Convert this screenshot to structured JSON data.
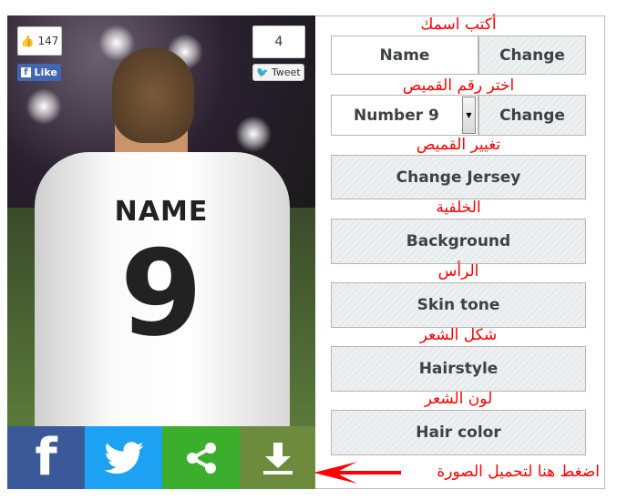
{
  "social": {
    "likes": "147",
    "like_label": "Like",
    "tweets": "4",
    "tweet_label": "Tweet"
  },
  "jersey": {
    "name": "NAME",
    "number": "9"
  },
  "share_bar": [
    {
      "icon": "facebook-icon",
      "color": "#3b5998"
    },
    {
      "icon": "twitter-icon",
      "color": "#1da1f2"
    },
    {
      "icon": "share-icon",
      "color": "#3cae2d"
    },
    {
      "icon": "download-icon",
      "color": "#6c8b3c"
    }
  ],
  "controls": {
    "name_label": "أكتب اسمك",
    "name_value": "Name",
    "name_change": "Change",
    "number_label": "اختر رقم القميص",
    "number_value": "Number 9",
    "number_change": "Change",
    "jersey_label": "تغيير القميص",
    "jersey_button": "Change Jersey",
    "background_label": "الخلفية",
    "background_button": "Background",
    "skin_label": "الرأس",
    "skin_button": "Skin tone",
    "hairstyle_label": "شكل الشعر",
    "hairstyle_button": "Hairstyle",
    "haircolor_label": "لون الشعر",
    "haircolor_button": "Hair color"
  },
  "download_hint": "اضغط هنا لتحميل الصورة",
  "colors": {
    "annotation": "#ff0000"
  }
}
